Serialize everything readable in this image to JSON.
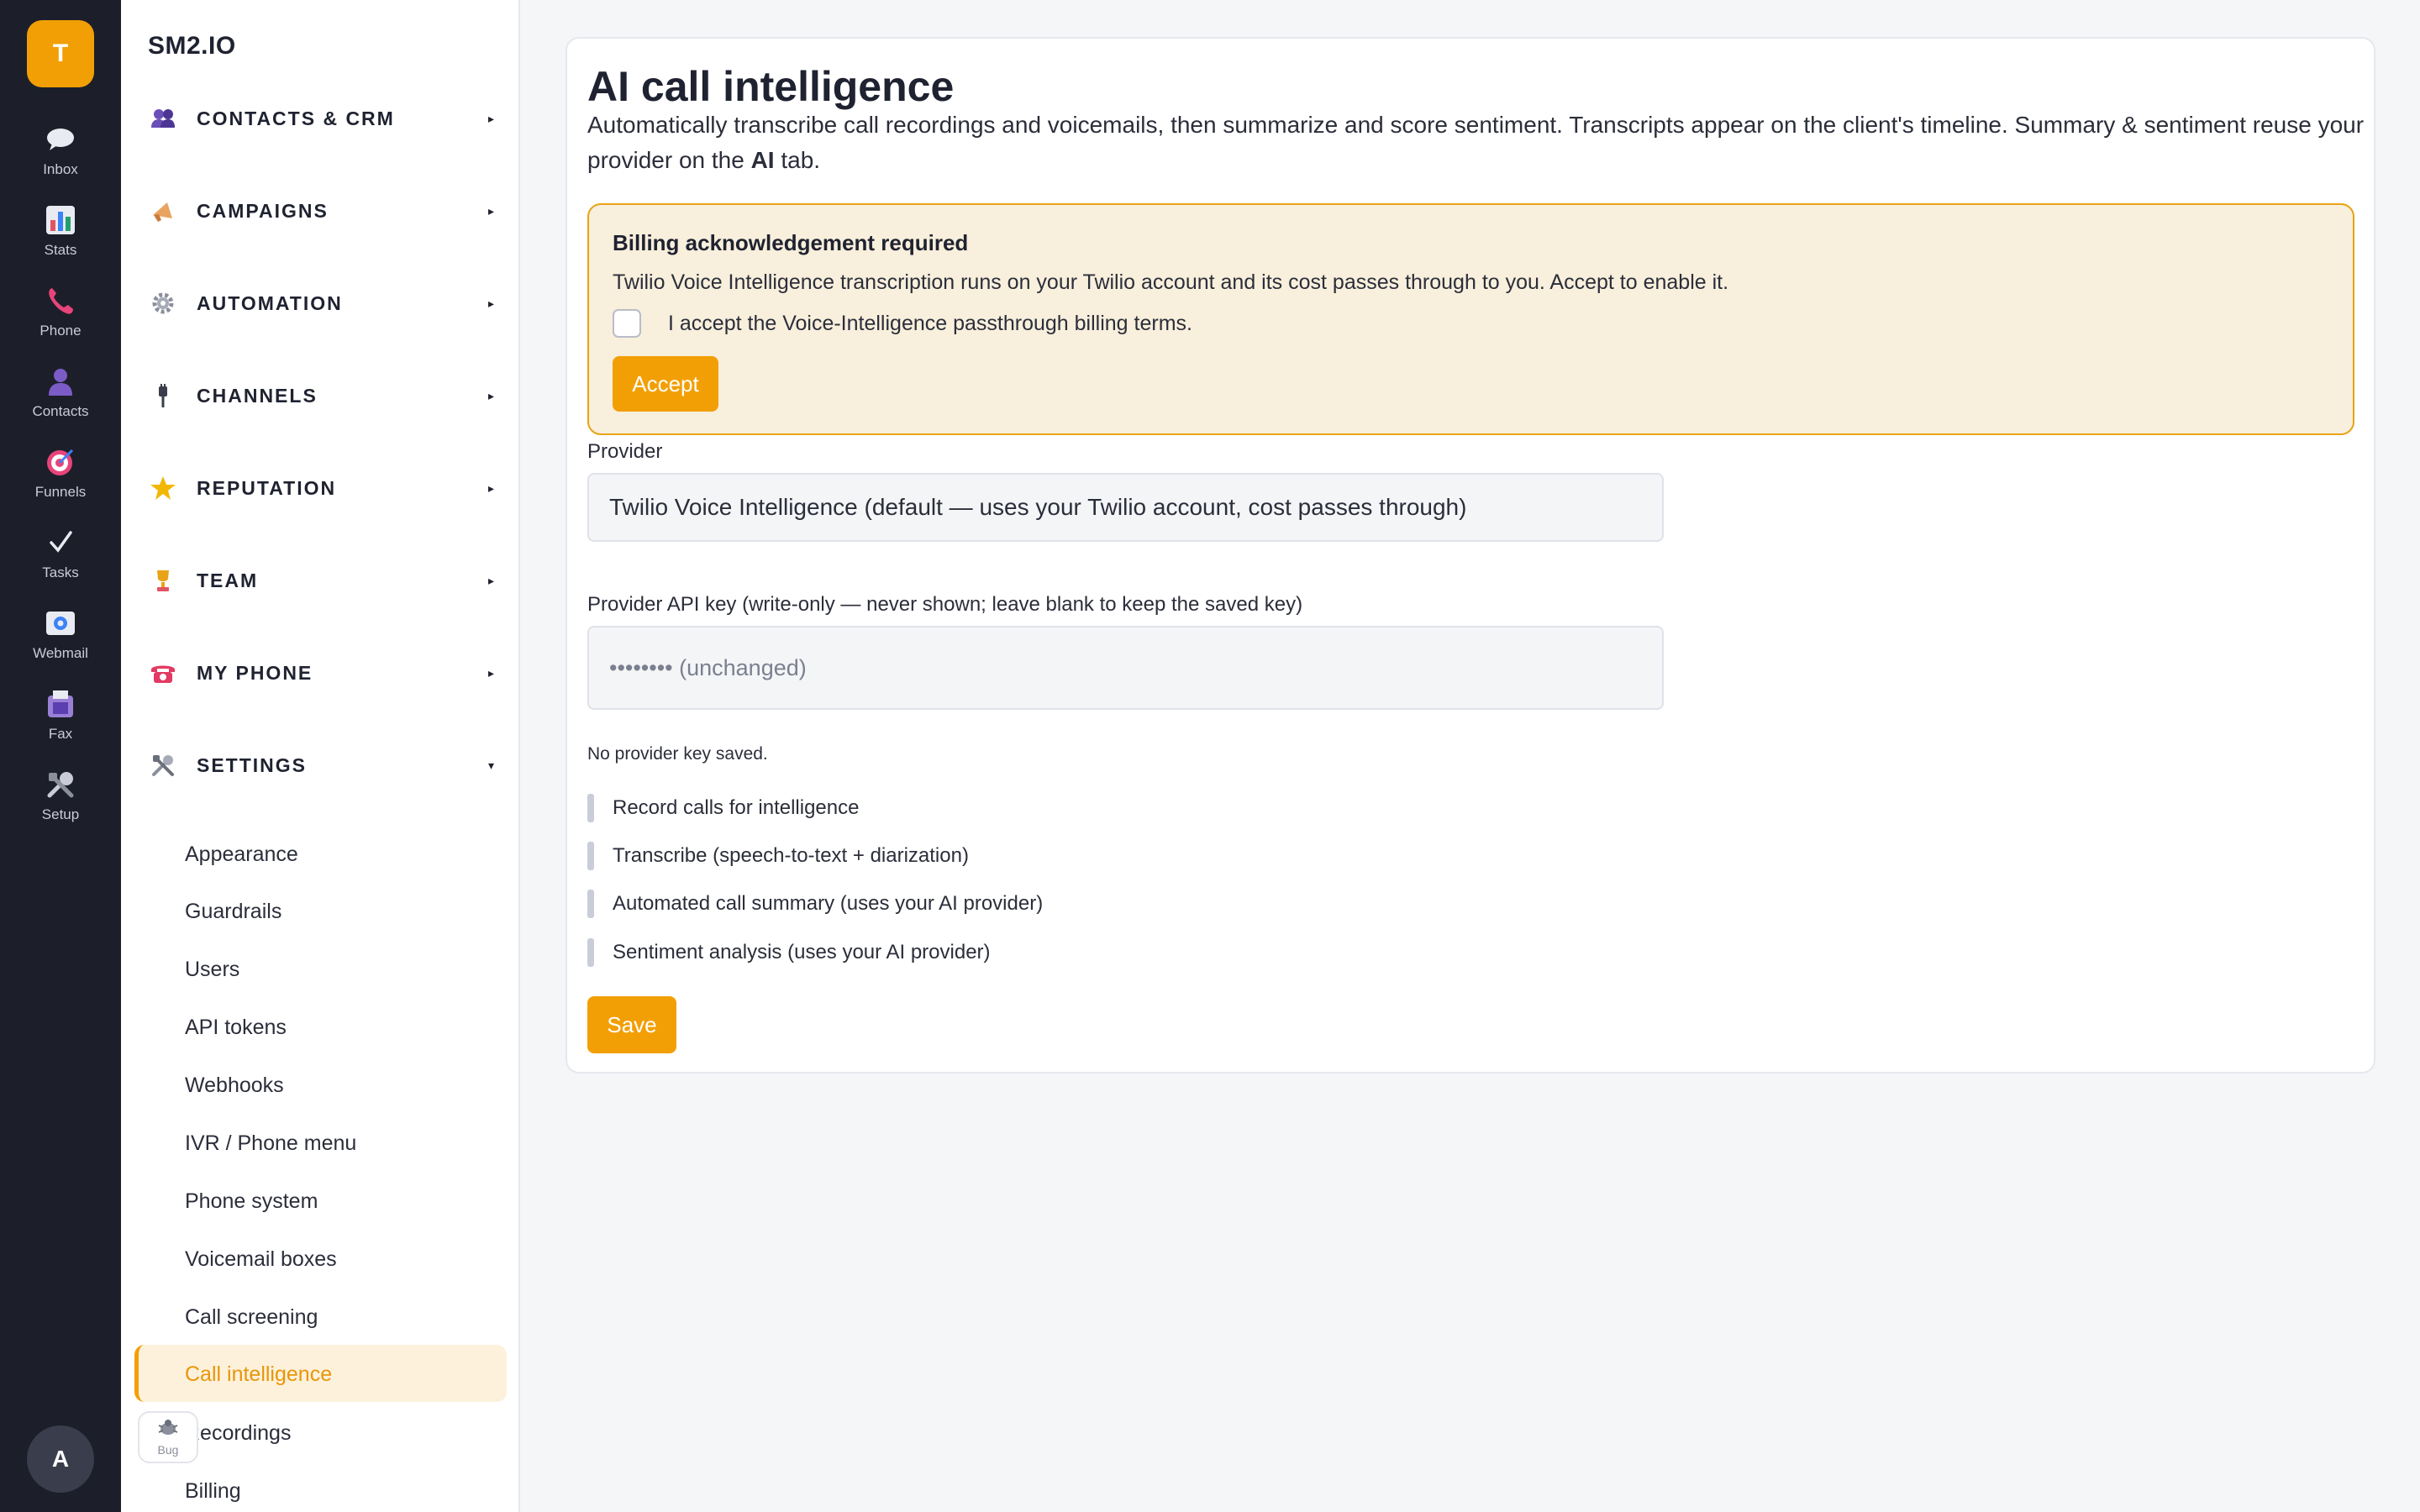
{
  "rail": {
    "logo_letter": "T",
    "items": [
      {
        "label": "Inbox",
        "icon": "chat-bubble-icon"
      },
      {
        "label": "Stats",
        "icon": "bar-chart-icon"
      },
      {
        "label": "Phone",
        "icon": "phone-icon"
      },
      {
        "label": "Contacts",
        "icon": "person-icon"
      },
      {
        "label": "Funnels",
        "icon": "target-icon"
      },
      {
        "label": "Tasks",
        "icon": "checkmark-icon"
      },
      {
        "label": "Webmail",
        "icon": "mail-icon"
      },
      {
        "label": "Fax",
        "icon": "fax-icon"
      },
      {
        "label": "Setup",
        "icon": "tools-icon"
      }
    ],
    "avatar_letter": "A"
  },
  "sidebar": {
    "brand": "SM2.IO",
    "groups": [
      {
        "label": "CONTACTS & CRM",
        "icon": "people-icon",
        "caret": "▸"
      },
      {
        "label": "CAMPAIGNS",
        "icon": "megaphone-icon",
        "caret": "▸"
      },
      {
        "label": "AUTOMATION",
        "icon": "gear-icon",
        "caret": "▸"
      },
      {
        "label": "CHANNELS",
        "icon": "plug-icon",
        "caret": "▸"
      },
      {
        "label": "REPUTATION",
        "icon": "star-icon",
        "caret": "▸"
      },
      {
        "label": "TEAM",
        "icon": "trophy-icon",
        "caret": "▸"
      },
      {
        "label": "MY PHONE",
        "icon": "telephone-icon",
        "caret": "▸"
      },
      {
        "label": "SETTINGS",
        "icon": "tools-icon",
        "caret": "▾"
      }
    ],
    "settings_items": [
      "Appearance",
      "Guardrails",
      "Users",
      "API tokens",
      "Webhooks",
      "IVR / Phone menu",
      "Phone system",
      "Voicemail boxes",
      "Call screening",
      "Call intelligence",
      "Recordings",
      "Billing"
    ],
    "active_item": "Call intelligence",
    "bug_label": "Bug"
  },
  "main": {
    "title": "AI call intelligence",
    "description_1": "Automatically transcribe call recordings and voicemails, then summarize and score sentiment. Transcripts appear on the client's timeline. Summary & sentiment reuse your provider on the ",
    "description_bold": "AI",
    "description_2": " tab.",
    "billing": {
      "title": "Billing acknowledgement required",
      "text": "Twilio Voice Intelligence transcription runs on your Twilio account and its cost passes through to you. Accept to enable it.",
      "checkbox_label": "I accept the Voice-Intelligence passthrough billing terms.",
      "accept_label": "Accept"
    },
    "provider_label": "Provider",
    "provider_value": "Twilio Voice Intelligence (default — uses your Twilio account, cost passes through)",
    "api_key_label": "Provider API key (write-only — never shown; leave blank to keep the saved key)",
    "api_key_placeholder": "•••••••• (unchanged)",
    "no_key_note": "No provider key saved.",
    "toggles": [
      "Record calls for intelligence",
      "Transcribe (speech-to-text + diarization)",
      "Automated call summary (uses your AI provider)",
      "Sentiment analysis (uses your AI provider)"
    ],
    "save_label": "Save"
  },
  "colors": {
    "accent": "#f29f05",
    "rail_bg": "#1c1f2a",
    "billing_bg": "#f8efdc",
    "active_text": "#e8960a"
  }
}
